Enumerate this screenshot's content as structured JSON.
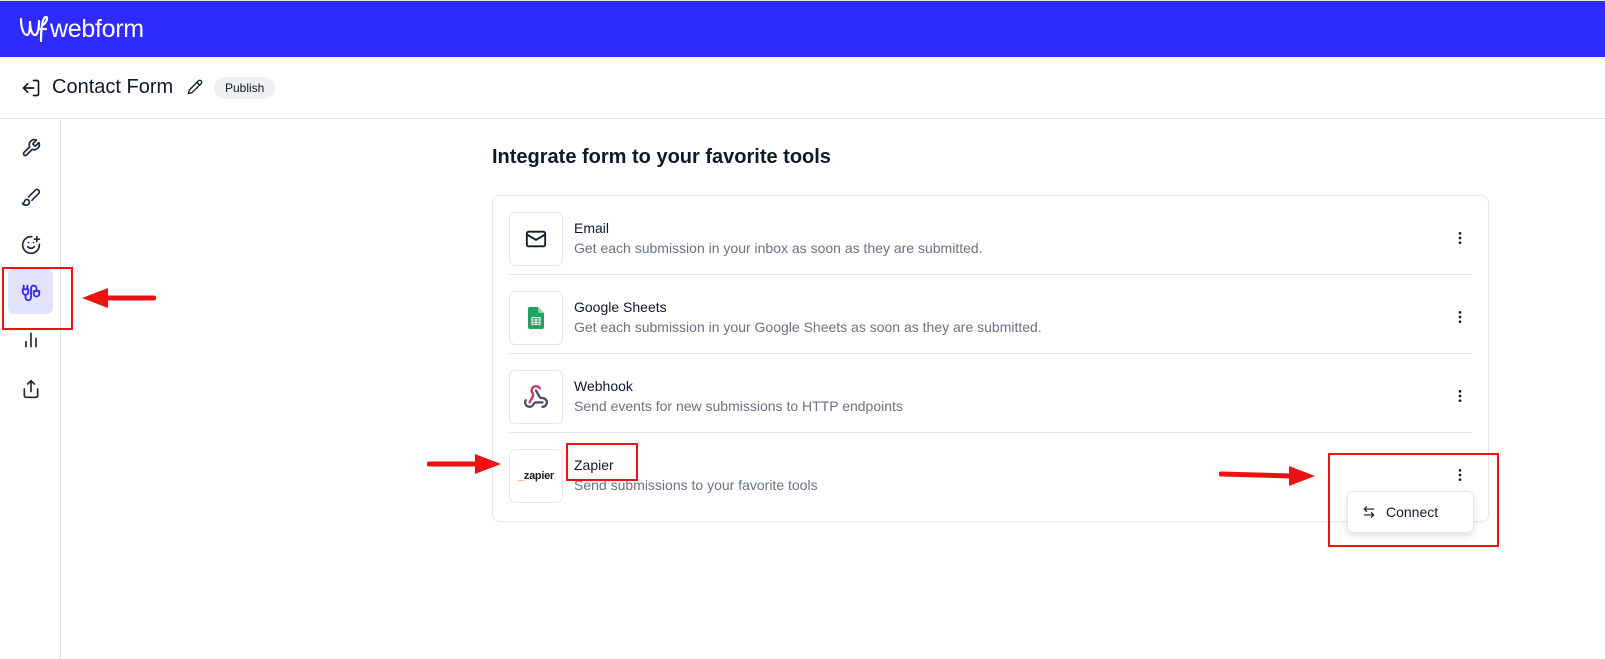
{
  "app": {
    "brand": "webform",
    "brand_color": "#2f2bff"
  },
  "header": {
    "title": "Contact Form",
    "status_badge": "Publish",
    "back_icon": "log-out-icon",
    "edit_icon": "pencil-icon"
  },
  "sidebar": {
    "items": [
      {
        "name": "settings",
        "icon": "wrench-icon",
        "active": false
      },
      {
        "name": "design",
        "icon": "paintbrush-icon",
        "active": false
      },
      {
        "name": "emoji",
        "icon": "smile-plus-icon",
        "active": false
      },
      {
        "name": "integrations",
        "icon": "plug-icon",
        "active": true
      },
      {
        "name": "analytics",
        "icon": "bar-chart-icon",
        "active": false
      },
      {
        "name": "share",
        "icon": "upload-icon",
        "active": false
      }
    ]
  },
  "main": {
    "title": "Integrate form to your favorite tools",
    "integrations": [
      {
        "name": "Email",
        "description": "Get each submission in your inbox as soon as they are submitted.",
        "icon": "mail-icon"
      },
      {
        "name": "Google Sheets",
        "description": "Get each submission in your Google Sheets as soon as they are submitted.",
        "icon": "google-sheets-icon"
      },
      {
        "name": "Webhook",
        "description": "Send events for new submissions to HTTP endpoints",
        "icon": "webhook-icon"
      },
      {
        "name": "Zapier",
        "description": "Send submissions to your favorite tools",
        "icon": "zapier-logo",
        "logo_text": "zapier"
      }
    ],
    "menu": {
      "items": [
        {
          "label": "Connect",
          "icon": "arrow-left-right-icon"
        }
      ]
    }
  },
  "annotations": {
    "highlight_color": "#ee1111"
  }
}
